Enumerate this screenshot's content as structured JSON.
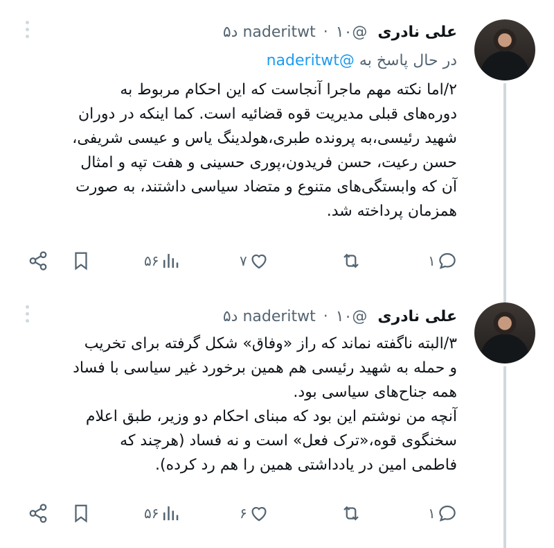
{
  "tweets": [
    {
      "author_name": "علی نادری",
      "handle": "@naderitwt",
      "separator": "·",
      "time": "۱۰ د۵",
      "replying_prefix": "در حال پاسخ به",
      "replying_to": "@naderitwt",
      "text": "۲/اما نکته مهم ماجرا آنجاست که این احکام مربوط به\nدوره‌های قبلی مدیریت قوه قضائیه است. کما اینکه در دوران\nشهید رئیسی،به پرونده طبری،هولدینگ یاس و عیسی شریفی،\nحسن رعیت، حسن فریدون،پوری حسینی و هفت تپه و امثال\nآن که وابستگی‌های متنوع و متضاد سیاسی داشتند، به صورت\nهمزمان پرداخته شد.",
      "actions": {
        "reply_count": "۱",
        "retweet_count": "",
        "like_count": "۷",
        "view_count": "۵۶"
      }
    },
    {
      "author_name": "علی نادری",
      "handle": "@naderitwt",
      "separator": "·",
      "time": "۱۰ د۵",
      "text": "۳/البته ناگفته نماند که راز «وفاق» شکل گرفته برای تخریب\nو حمله به شهید رئیسی هم همین برخورد غیر سیاسی با فساد\nهمه جناح‌های سیاسی بود.\nآنچه من نوشتم این بود که مبنای احکام دو وزیر، طبق اعلام\nسخنگوی قوه،«ترک فعل» است و نه فساد (هرچند که\nفاطمی امین در یادداشتی همین را هم رد کرده).",
      "actions": {
        "reply_count": "۱",
        "retweet_count": "",
        "like_count": "۶",
        "view_count": "۵۶"
      }
    }
  ],
  "colors": {
    "text": "#0f1419",
    "secondary": "#536471",
    "link": "#1d9bf0",
    "thread_line": "#cfd9de"
  },
  "icons": [
    "share-icon",
    "bookmark-icon",
    "views-icon",
    "like-icon",
    "retweet-icon",
    "reply-icon",
    "more-icon",
    "avatar"
  ]
}
